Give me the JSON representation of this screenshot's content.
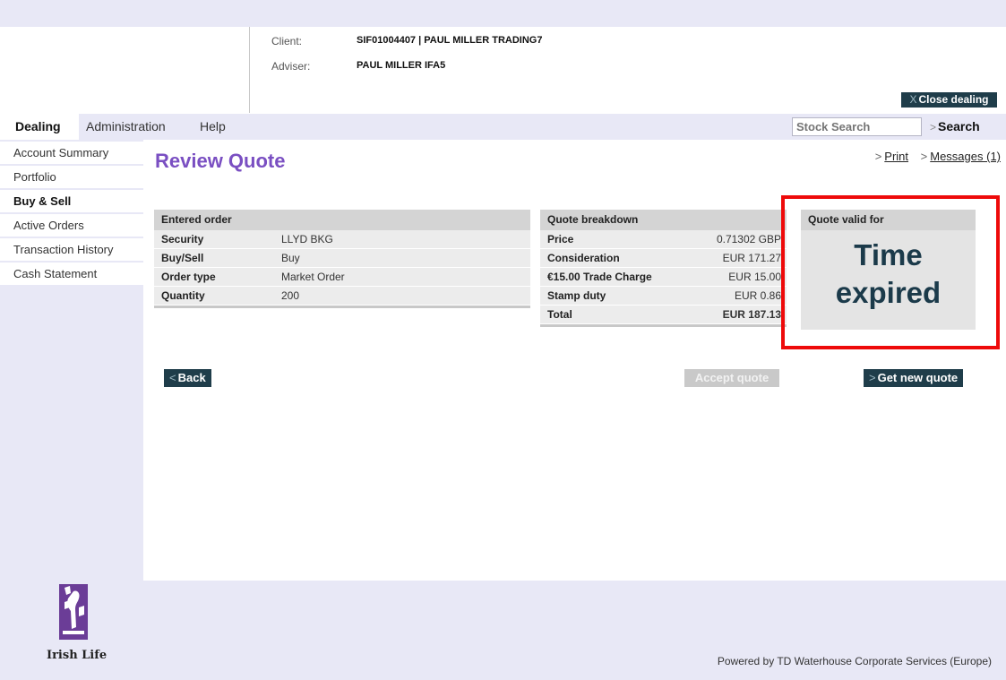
{
  "header": {
    "client_label": "Client:",
    "client_value": "SIF01004407 | PAUL MILLER TRADING7",
    "adviser_label": "Adviser:",
    "adviser_value": "PAUL MILLER IFA5",
    "close_dealing_prefix": "X",
    "close_dealing_label": "Close dealing"
  },
  "nav": {
    "tabs": [
      {
        "label": "Dealing",
        "active": true
      },
      {
        "label": "Administration",
        "active": false
      },
      {
        "label": "Help",
        "active": false
      }
    ],
    "stock_search_placeholder": "Stock Search",
    "search_arrow": ">",
    "search_label": "Search"
  },
  "sidebar": {
    "items": [
      {
        "label": "Account Summary",
        "active": false
      },
      {
        "label": "Portfolio",
        "active": false
      },
      {
        "label": "Buy & Sell",
        "active": true
      },
      {
        "label": "Active Orders",
        "active": false
      },
      {
        "label": "Transaction History",
        "active": false
      },
      {
        "label": "Cash Statement",
        "active": false
      }
    ]
  },
  "main": {
    "title": "Review Quote",
    "links": {
      "arrow": ">",
      "print": "Print",
      "messages": "Messages (1)"
    },
    "entered_order": {
      "heading": "Entered order",
      "rows": [
        {
          "label": "Security",
          "value": "LLYD BKG"
        },
        {
          "label": "Buy/Sell",
          "value": "Buy"
        },
        {
          "label": "Order type",
          "value": "Market Order"
        },
        {
          "label": "Quantity",
          "value": "200"
        }
      ]
    },
    "quote_breakdown": {
      "heading": "Quote breakdown",
      "rows": [
        {
          "label": "Price",
          "value": "0.71302 GBP"
        },
        {
          "label": "Consideration",
          "value": "EUR 171.27"
        },
        {
          "label": "€15.00 Trade Charge",
          "value": "EUR 15.00"
        },
        {
          "label": "Stamp duty",
          "value": "EUR 0.86"
        },
        {
          "label": "Total",
          "value": "EUR 187.13"
        }
      ]
    },
    "quote_valid": {
      "heading": "Quote valid for",
      "line1": "Time",
      "line2": "expired"
    },
    "buttons": {
      "arrow": "<",
      "back": "Back",
      "accept_quote": "Accept quote",
      "next_arrow": ">",
      "get_new_quote": "Get new quote"
    }
  },
  "footer": {
    "logo_text": "Irish Life",
    "powered_by": "Powered by TD Waterhouse Corporate Services (Europe)"
  },
  "colors": {
    "nav_background": "#e8e8f6",
    "title_purple": "#7a4fc2",
    "dark_button": "#1f3d4a",
    "highlight_red": "#ee0a0a",
    "time_expired_text": "#1b3a4a"
  }
}
